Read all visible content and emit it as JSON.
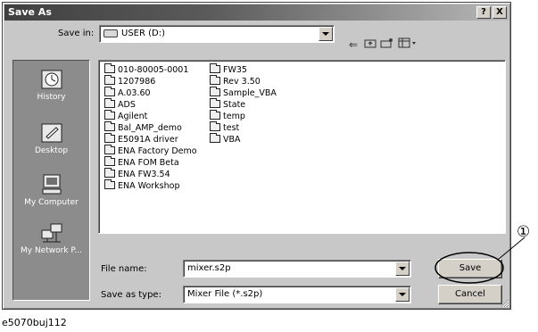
{
  "window": {
    "title": "Save As",
    "help_label": "?",
    "close_label": "X"
  },
  "save_in": {
    "label": "Save in:",
    "value": "USER (D:)"
  },
  "places": [
    {
      "label": "History"
    },
    {
      "label": "Desktop"
    },
    {
      "label": "My Computer"
    },
    {
      "label": "My Network P..."
    }
  ],
  "files": {
    "col1": [
      "010-80005-0001",
      "1207986",
      "A.03.60",
      "ADS",
      "Agilent",
      "Bal_AMP_demo",
      "E5091A driver",
      "ENA Factory Demo",
      "ENA FOM Beta",
      "ENA FW3.54",
      "ENA Workshop"
    ],
    "col2": [
      "FW35",
      "Rev 3.50",
      "Sample_VBA",
      "State",
      "temp",
      "test",
      "VBA"
    ]
  },
  "file_name": {
    "label": "File name:",
    "value": "mixer.s2p"
  },
  "save_as_type": {
    "label": "Save as type:",
    "value": "Mixer File (*.s2p)"
  },
  "buttons": {
    "save": "Save",
    "cancel": "Cancel"
  },
  "callout": {
    "number": "①"
  },
  "caption": "e5070buj112"
}
